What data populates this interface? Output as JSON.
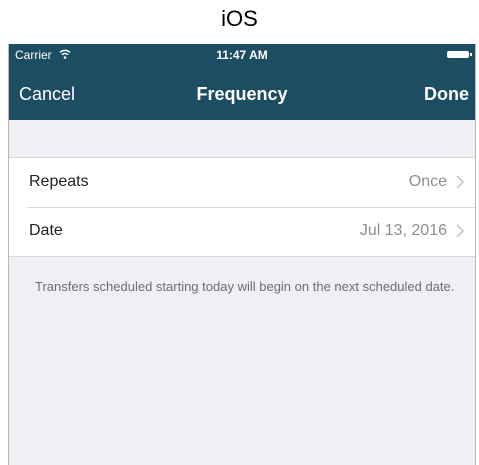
{
  "caption": "iOS",
  "status_bar": {
    "carrier": "Carrier",
    "time": "11:47 AM",
    "wifi_icon": "wifi-icon",
    "battery_icon": "battery-icon"
  },
  "navbar": {
    "cancel_label": "Cancel",
    "title": "Frequency",
    "done_label": "Done",
    "background_color": "#1d4d63"
  },
  "rows": [
    {
      "label": "Repeats",
      "value": "Once",
      "icon": "chevron-right-icon"
    },
    {
      "label": "Date",
      "value": "Jul 13, 2016",
      "icon": "chevron-right-icon"
    }
  ],
  "footer_note": "Transfers scheduled starting today will begin on the next scheduled date."
}
